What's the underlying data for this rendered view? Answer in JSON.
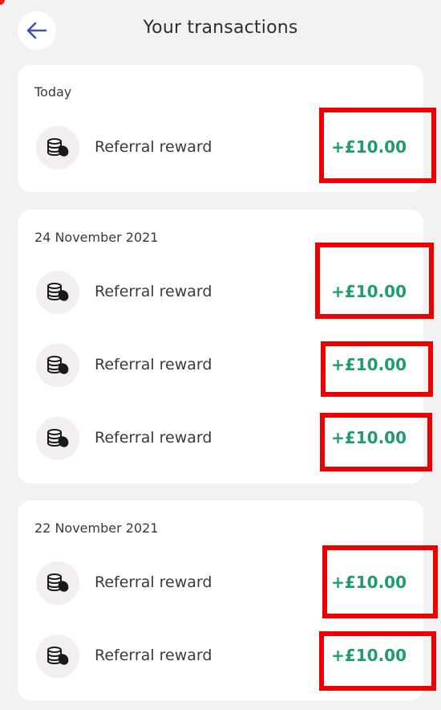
{
  "header": {
    "title": "Your transactions",
    "back_icon": "arrow-left-icon",
    "back_icon_color": "#3f51b5"
  },
  "colors": {
    "background": "#f2f2f2",
    "card": "#ffffff",
    "amount_positive": "#1e9d6b",
    "highlight": "#ee0000"
  },
  "groups": [
    {
      "date": "Today",
      "transactions": [
        {
          "icon": "coins-icon",
          "label": "Referral reward",
          "amount": "+£10.00"
        }
      ]
    },
    {
      "date": "24 November 2021",
      "transactions": [
        {
          "icon": "coins-icon",
          "label": "Referral reward",
          "amount": "+£10.00"
        },
        {
          "icon": "coins-icon",
          "label": "Referral reward",
          "amount": "+£10.00"
        },
        {
          "icon": "coins-icon",
          "label": "Referral reward",
          "amount": "+£10.00"
        }
      ]
    },
    {
      "date": "22 November 2021",
      "transactions": [
        {
          "icon": "coins-icon",
          "label": "Referral reward",
          "amount": "+£10.00"
        },
        {
          "icon": "coins-icon",
          "label": "Referral reward",
          "amount": "+£10.00"
        }
      ]
    }
  ]
}
